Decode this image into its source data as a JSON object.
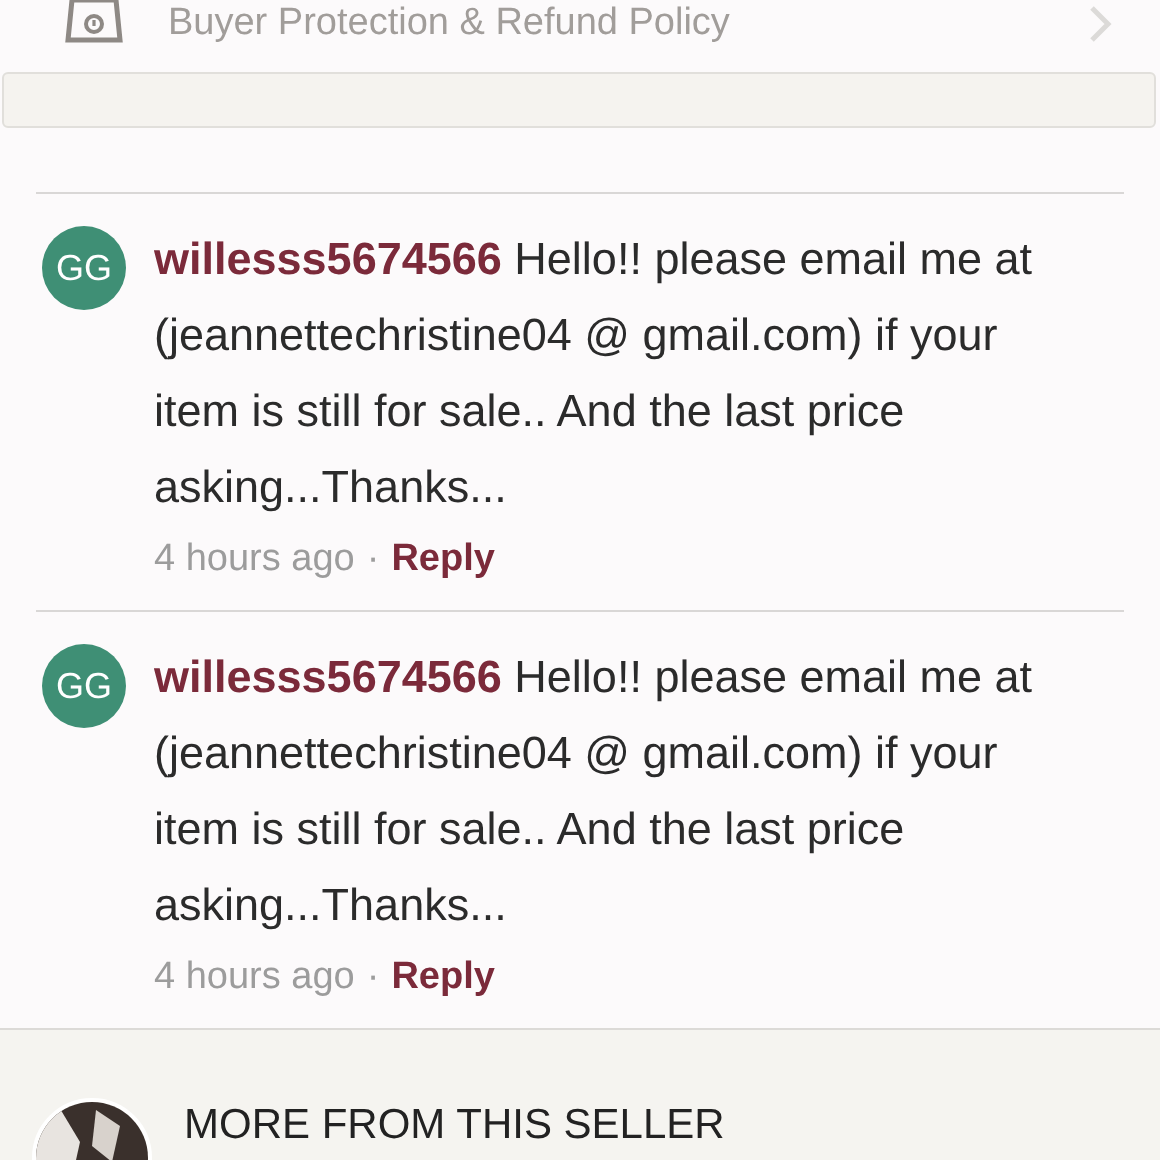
{
  "policy_row": {
    "label": "Buyer Protection & Refund Policy"
  },
  "comments": [
    {
      "initials": "GG",
      "color": "#3f8f75",
      "username": "willesss5674566",
      "text": "Hello!! please email me at (jeannettechristine04 @ gmail.com) if your item is still for sale.. And the last price asking...Thanks...",
      "time": "4 hours ago",
      "separator": "·",
      "reply": "Reply"
    },
    {
      "initials": "GG",
      "color": "#3f8f75",
      "username": "willesss5674566",
      "text": "Hello!! please email me at (jeannettechristine04 @ gmail.com) if your item is still for sale.. And the last price asking...Thanks...",
      "time": "4 hours ago",
      "separator": "·",
      "reply": "Reply"
    }
  ],
  "seller_section": {
    "heading": "MORE FROM THIS SELLER"
  }
}
